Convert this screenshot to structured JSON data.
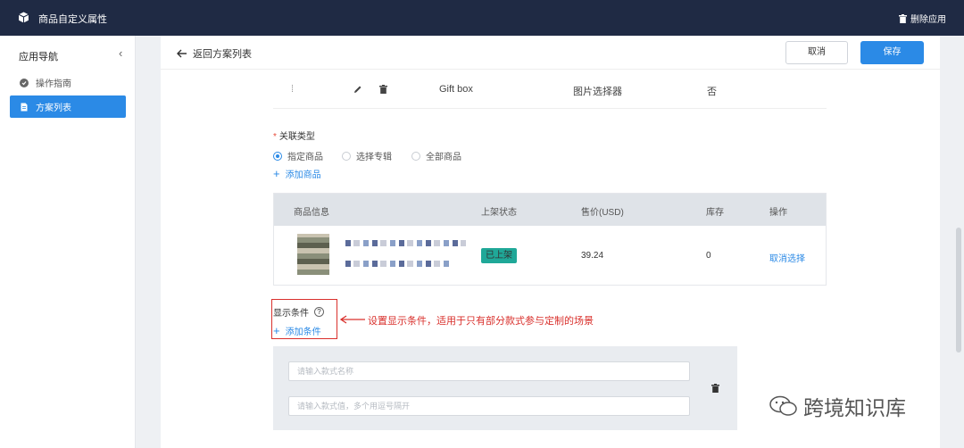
{
  "topbar": {
    "app_title": "商品自定义属性",
    "delete_app": "删除应用"
  },
  "sidebar": {
    "title": "应用导航",
    "items": [
      {
        "label": "操作指南",
        "icon": "guide-icon",
        "active": false
      },
      {
        "label": "方案列表",
        "icon": "document-icon",
        "active": true
      }
    ]
  },
  "header": {
    "back_label": "返回方案列表",
    "cancel_label": "取消",
    "save_label": "保存"
  },
  "attribute_row": {
    "name": "Gift box",
    "type": "图片选择器",
    "required": "否"
  },
  "relation": {
    "label": "关联类型",
    "options": [
      {
        "label": "指定商品",
        "selected": true
      },
      {
        "label": "选择专辑",
        "selected": false
      },
      {
        "label": "全部商品",
        "selected": false
      }
    ],
    "add_product": "添加商品"
  },
  "product_table": {
    "columns": [
      "商品信息",
      "上架状态",
      "售价(USD)",
      "库存",
      "操作"
    ],
    "rows": [
      {
        "status": "已上架",
        "price": "39.24",
        "stock": "0",
        "action": "取消选择"
      }
    ]
  },
  "display_condition": {
    "label": "显示条件",
    "add_label": "添加条件",
    "annotation": "设置显示条件，适用于只有部分款式参与定制的场景",
    "style_name_placeholder": "请输入款式名称",
    "style_value_placeholder": "请输入款式值，多个用逗号隔开"
  },
  "watermark": "跨境知识库",
  "colors": {
    "topbar": "#1f2a44",
    "accent": "#2b8ae6",
    "badge": "#1fa898",
    "annotation": "#d9302c"
  }
}
